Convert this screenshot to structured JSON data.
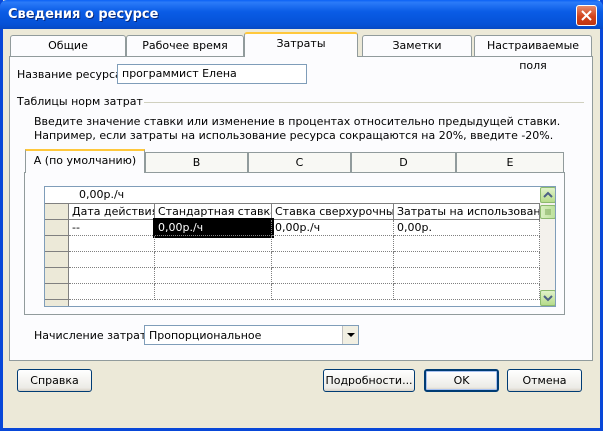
{
  "window": {
    "title": "Сведения о ресурсе"
  },
  "tabs": [
    {
      "label": "Общие"
    },
    {
      "label": "Рабочее время"
    },
    {
      "label": "Затраты"
    },
    {
      "label": "Заметки"
    },
    {
      "label": "Настраиваемые поля"
    }
  ],
  "resource": {
    "name_label": "Название ресурса:",
    "name_value": "программист Елена"
  },
  "rates": {
    "group_label": "Таблицы норм затрат",
    "instructions": "Введите значение ставки или изменение в процентах относительно предыдущей ставки. Например, если затраты на использование ресурса сокращаются на 20%, введите -20%.",
    "tables": [
      {
        "label": "A (по умолчанию)"
      },
      {
        "label": "B"
      },
      {
        "label": "C"
      },
      {
        "label": "D"
      },
      {
        "label": "E"
      }
    ],
    "edit_value": "0,00р./ч",
    "columns": [
      "Дата действия",
      "Стандартная ставка",
      "Ставка сверхурочных",
      "Затраты на использование"
    ],
    "rows": [
      [
        "--",
        "0,00р./ч",
        "0,00р./ч",
        "0,00р."
      ]
    ]
  },
  "accrual": {
    "label": "Начисление затрат:",
    "value": "Пропорциональное"
  },
  "buttons": {
    "help": "Справка",
    "details": "Подробности...",
    "ok": "OK",
    "cancel": "Отмена"
  },
  "colors": {
    "titlebar": "#0A5CE6",
    "dialog": "#ECE9D8",
    "active_tab_accent": "#FFC83C"
  }
}
